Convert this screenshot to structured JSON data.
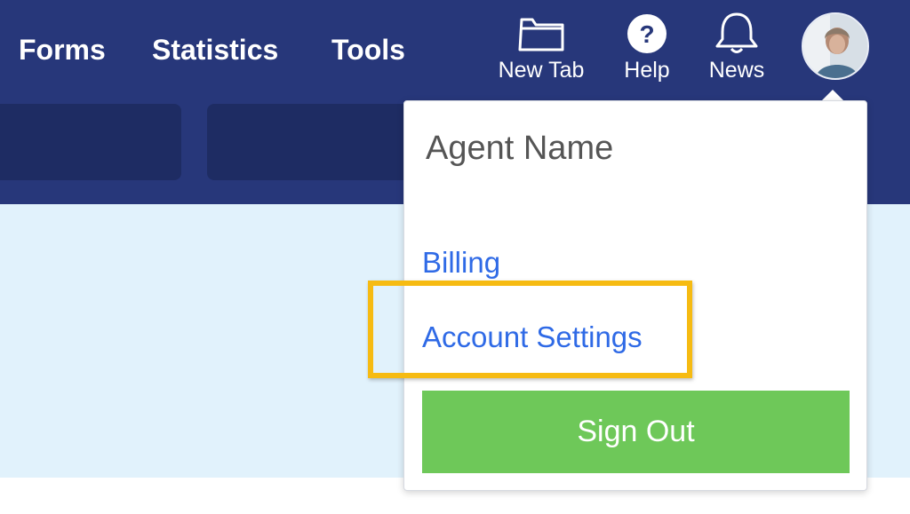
{
  "nav": {
    "forms": "Forms",
    "statistics": "Statistics",
    "tools": "Tools"
  },
  "actions": {
    "new_tab": "New Tab",
    "help": "Help",
    "news": "News"
  },
  "account_menu": {
    "agent_name": "Agent Name",
    "billing": "Billing",
    "account_settings": "Account Settings",
    "sign_out": "Sign Out"
  },
  "colors": {
    "header": "#27377a",
    "link": "#2f6ae6",
    "sign_out": "#6ec859",
    "highlight": "#f6bb12",
    "content_bg": "#e1f2fc"
  },
  "icons": [
    "folder-icon",
    "help-icon",
    "bell-icon",
    "avatar"
  ]
}
